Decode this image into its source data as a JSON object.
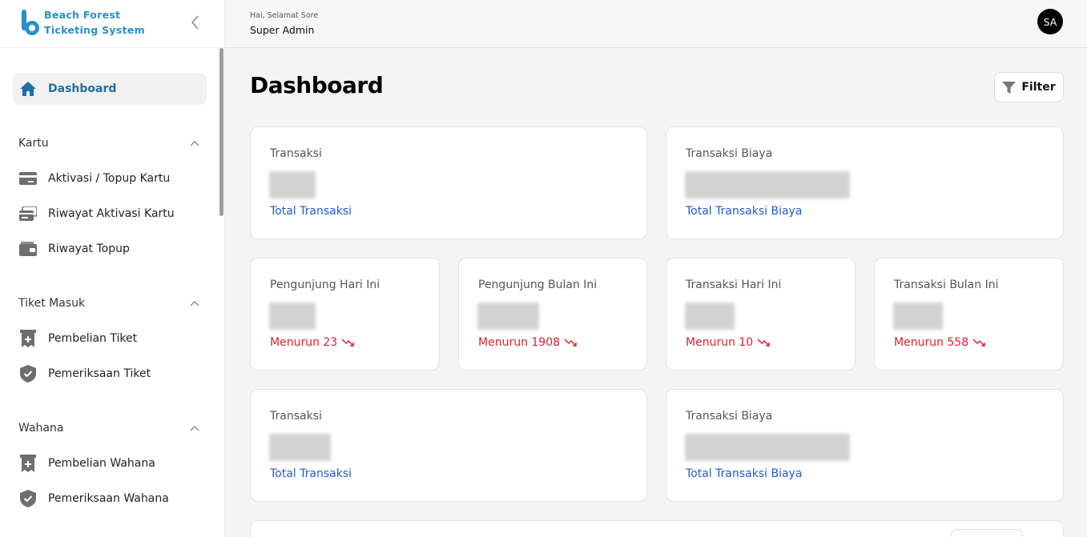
{
  "brand": {
    "line1": "Beach Forest",
    "line2": "Ticketing System"
  },
  "header": {
    "greeting": "Hai, Selamat Sore",
    "user": "Super Admin",
    "avatar": "SA"
  },
  "sidebar": {
    "dashboard": "Dashboard",
    "sections": [
      {
        "title": "Kartu",
        "items": [
          "Aktivasi / Topup Kartu",
          "Riwayat Aktivasi Kartu",
          "Riwayat Topup"
        ]
      },
      {
        "title": "Tiket Masuk",
        "items": [
          "Pembelian Tiket",
          "Pemeriksaan Tiket"
        ]
      },
      {
        "title": "Wahana",
        "items": [
          "Pembelian Wahana",
          "Pemeriksaan Wahana"
        ]
      }
    ]
  },
  "main": {
    "title": "Dashboard",
    "filter_label": "Filter",
    "cards": [
      {
        "label": "Transaksi",
        "sub": "Total Transaksi"
      },
      {
        "label": "Transaksi Biaya",
        "sub": "Total Transaksi Biaya"
      },
      {
        "label": "Pengunjung Hari Ini",
        "sub": "Menurun 23"
      },
      {
        "label": "Pengunjung Bulan Ini",
        "sub": "Menurun 1908"
      },
      {
        "label": "Transaksi Hari Ini",
        "sub": "Menurun 10"
      },
      {
        "label": "Transaksi Bulan Ini",
        "sub": "Menurun 558"
      },
      {
        "label": "Transaksi",
        "sub": "Total Transaksi"
      },
      {
        "label": "Transaksi Biaya",
        "sub": "Total Transaksi Biaya"
      }
    ]
  },
  "colors": {
    "brand": "#2a8fc7",
    "link": "#2458d6",
    "down": "#d6232f",
    "active": "#1d6fa8"
  },
  "icons": [
    "home-icon",
    "card-icon",
    "card-history-icon",
    "wallet-icon",
    "ticket-icon",
    "shield-check-icon",
    "chevron-up-icon",
    "chevron-left-icon",
    "filter-icon",
    "trend-down-icon"
  ]
}
